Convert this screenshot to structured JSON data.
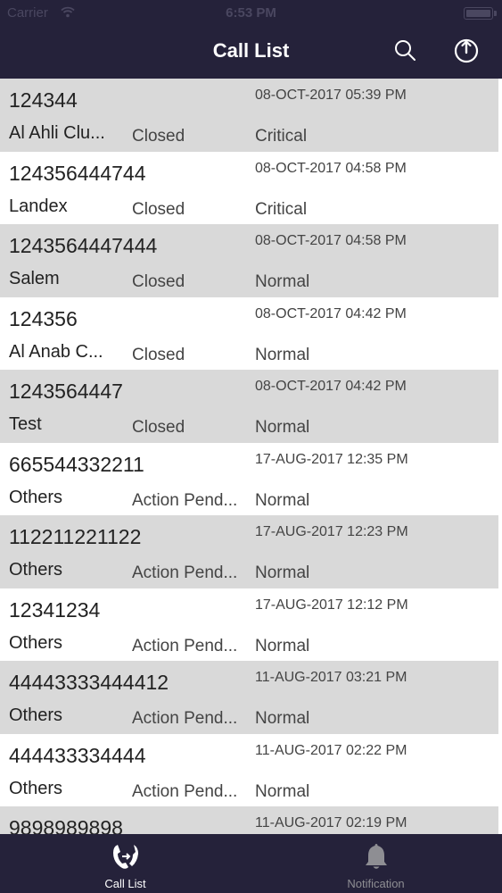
{
  "status_bar": {
    "carrier": "Carrier",
    "time": "6:53 PM"
  },
  "nav": {
    "title": "Call List",
    "search_icon": "search-icon",
    "logout_icon": "power-icon"
  },
  "colors": {
    "nav_background": "#25223a",
    "row_shaded": "#d9d9d9",
    "row_plain": "#ffffff",
    "tab_active": "#ffffff",
    "tab_inactive": "#8e8e93"
  },
  "calls": [
    {
      "number": "124344",
      "datetime": "08-OCT-2017 05:39 PM",
      "name": "Al Ahli Clu...",
      "status": "Closed",
      "priority": "Critical"
    },
    {
      "number": "124356444744",
      "datetime": "08-OCT-2017 04:58 PM",
      "name": "Landex",
      "status": "Closed",
      "priority": "Critical"
    },
    {
      "number": "1243564447444",
      "datetime": "08-OCT-2017 04:58 PM",
      "name": "Salem",
      "status": "Closed",
      "priority": "Normal"
    },
    {
      "number": "124356",
      "datetime": "08-OCT-2017 04:42 PM",
      "name": "Al Anab C...",
      "status": "Closed",
      "priority": "Normal"
    },
    {
      "number": "1243564447",
      "datetime": "08-OCT-2017 04:42 PM",
      "name": "Test",
      "status": "Closed",
      "priority": "Normal"
    },
    {
      "number": "665544332211",
      "datetime": "17-AUG-2017 12:35 PM",
      "name": "Others",
      "status": "Action Pend...",
      "priority": "Normal"
    },
    {
      "number": "112211221122",
      "datetime": "17-AUG-2017 12:23 PM",
      "name": "Others",
      "status": "Action Pend...",
      "priority": "Normal"
    },
    {
      "number": "12341234",
      "datetime": "17-AUG-2017 12:12 PM",
      "name": "Others",
      "status": "Action Pend...",
      "priority": "Normal"
    },
    {
      "number": "44443333444412",
      "datetime": "11-AUG-2017 03:21 PM",
      "name": "Others",
      "status": "Action Pend...",
      "priority": "Normal"
    },
    {
      "number": "444433334444",
      "datetime": "11-AUG-2017 02:22 PM",
      "name": "Others",
      "status": "Action Pend...",
      "priority": "Normal"
    },
    {
      "number": "9898989898",
      "datetime": "11-AUG-2017 02:19 PM",
      "name": "",
      "status": "",
      "priority": ""
    }
  ],
  "tabs": [
    {
      "label": "Call List",
      "icon": "phone-transfer-icon",
      "active": true
    },
    {
      "label": "Notification",
      "icon": "bell-icon",
      "active": false
    }
  ]
}
